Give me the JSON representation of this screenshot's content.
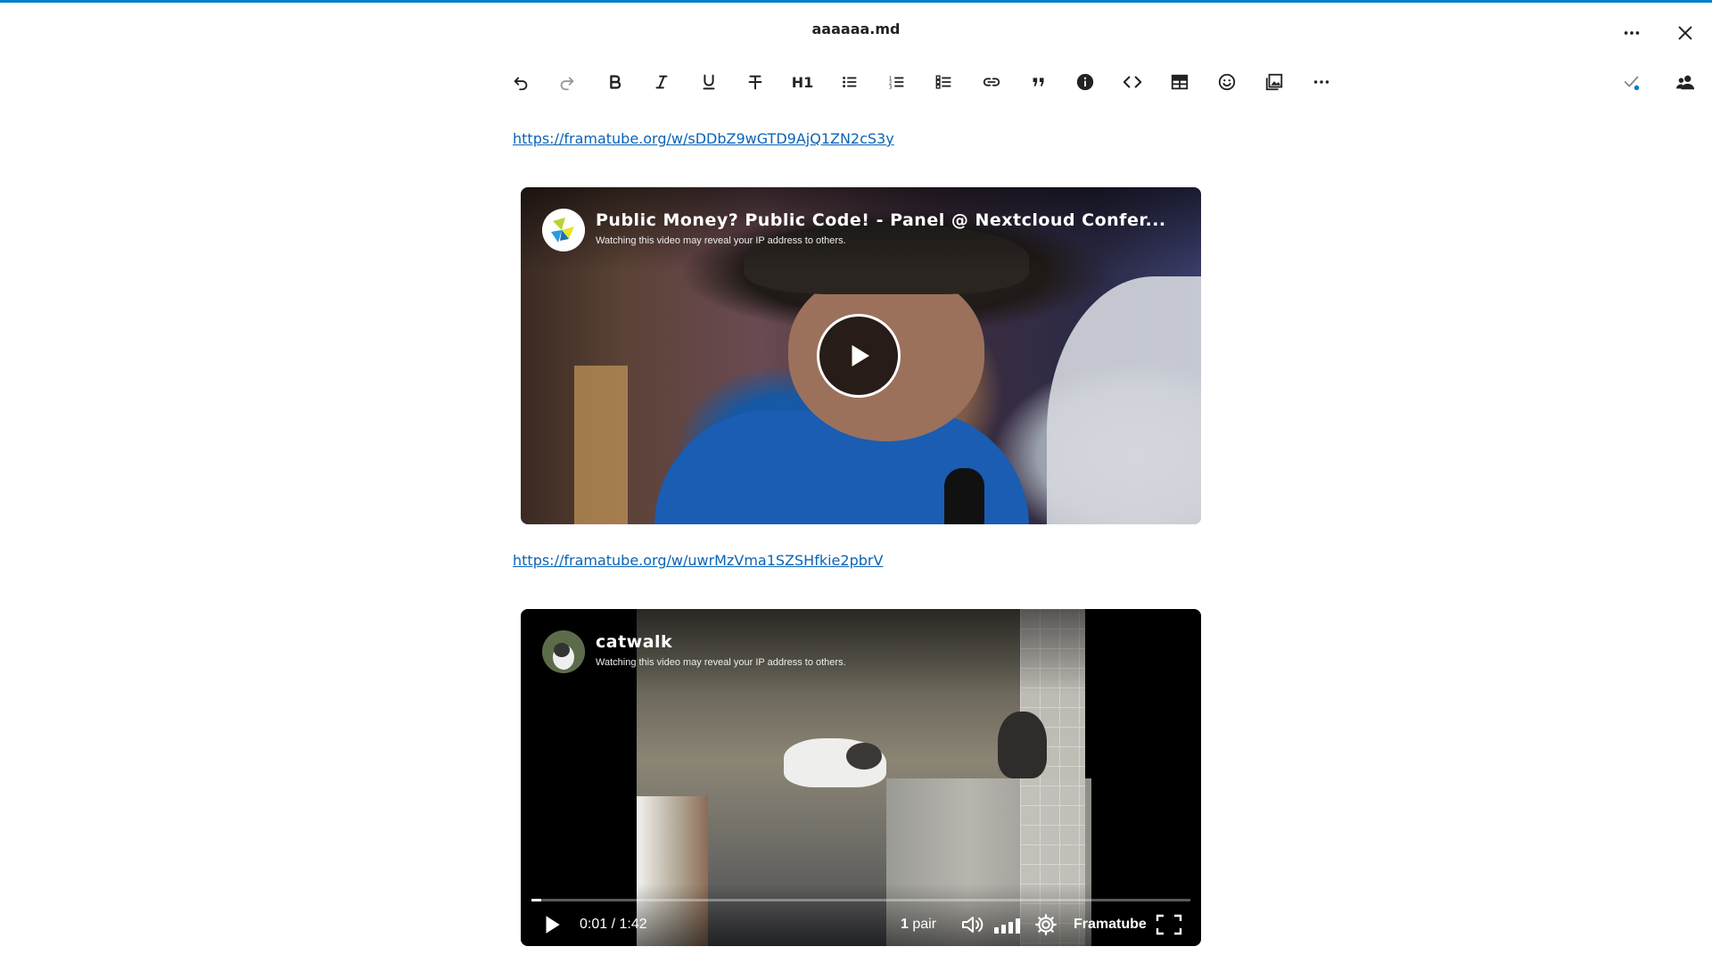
{
  "header": {
    "title": "aaaaaa.md",
    "menu_icon": "more-horizontal-icon",
    "close_icon": "close-icon"
  },
  "toolbar": {
    "items": [
      {
        "name": "undo",
        "icon": "undo-icon"
      },
      {
        "name": "redo",
        "icon": "redo-icon"
      },
      {
        "name": "bold",
        "icon": "bold-icon"
      },
      {
        "name": "italic",
        "icon": "italic-icon"
      },
      {
        "name": "underline",
        "icon": "underline-icon"
      },
      {
        "name": "strikethrough",
        "icon": "strikethrough-icon"
      },
      {
        "name": "heading",
        "label": "H1"
      },
      {
        "name": "bullet-list",
        "icon": "bullet-list-icon"
      },
      {
        "name": "ordered-list",
        "icon": "ordered-list-icon"
      },
      {
        "name": "task-list",
        "icon": "task-list-icon"
      },
      {
        "name": "link",
        "icon": "link-icon"
      },
      {
        "name": "blockquote",
        "icon": "quote-icon"
      },
      {
        "name": "callout",
        "icon": "info-icon"
      },
      {
        "name": "code-block",
        "icon": "code-icon"
      },
      {
        "name": "table",
        "icon": "table-icon"
      },
      {
        "name": "emoji",
        "icon": "emoji-icon"
      },
      {
        "name": "image",
        "icon": "image-icon"
      },
      {
        "name": "more",
        "icon": "more-horizontal-icon"
      }
    ],
    "status_icon": "check-sync-icon",
    "sessions_icon": "users-icon"
  },
  "content": {
    "link1": "https://framatube.org/w/sDDbZ9wGTD9AjQ1ZN2cS3y",
    "video1": {
      "title": "Public Money? Public Code! - Panel @ Nextcloud Confer...",
      "warning": "Watching this video may reveal your IP address to others."
    },
    "link2": "https://framatube.org/w/uwrMzVma1SZSHfkie2pbrV",
    "video2": {
      "title": "catwalk",
      "warning": "Watching this video may reveal your IP address to others.",
      "time": "0:01 / 1:42",
      "resolution_num": "1",
      "resolution_label": "pair",
      "brand": "Framatube",
      "progress": 0.01
    }
  },
  "colors": {
    "accent": "#0082c9",
    "link": "#0b63b6",
    "status_dot": "#0082c9"
  }
}
